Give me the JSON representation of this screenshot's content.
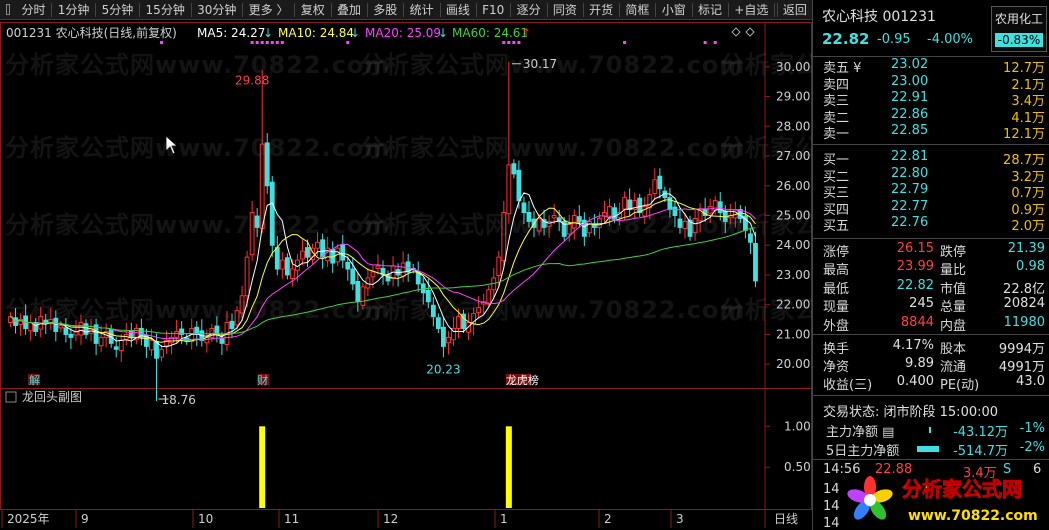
{
  "toolbar": {
    "items": [
      "分时",
      "1分钟",
      "5分钟",
      "15分钟",
      "30分钟",
      "更多 〉",
      "复权",
      "叠加",
      "多股",
      "统计",
      "画线",
      "F10",
      "逐分",
      "同资",
      "开货",
      "简框",
      "小窗",
      "标记",
      "+自选",
      "返回"
    ]
  },
  "chart_header": {
    "code_name": "001231 农心科技(日线,前复权)",
    "ma5": "MA5: 24.27",
    "ma10": "MA10: 24.84",
    "ma20": "MA20: 25.09",
    "ma60": "MA60: 24.61",
    "arrow_down": "↓",
    "arrow_up": "↑"
  },
  "sub_chart": {
    "title": "龙回头副图"
  },
  "annotations": {
    "high_label": "29.88",
    "high2_label": "30.17",
    "low_label": "20.23",
    "low2_label": "18.76",
    "event_jie": "解",
    "event_cai": "财",
    "event_lhb": "龙虎榜"
  },
  "colors": {
    "up": "#ff3030",
    "down": "#3fe0e0",
    "ma5": "#ffffff",
    "ma10": "#ffff40",
    "ma20": "#ff40ff",
    "ma60": "#40d040",
    "signal": "#ffff00"
  },
  "chart_data": [
    {
      "type": "candlestick",
      "y_ticks": [
        "30.00",
        "29.00",
        "28.00",
        "27.00",
        "26.00",
        "25.00",
        "24.00",
        "23.00",
        "22.00",
        "21.00",
        "20.00"
      ],
      "x_ticks": [
        "2025年",
        "9",
        "10",
        "11",
        "12",
        "1",
        "2",
        "3"
      ],
      "ylim": [
        19.4,
        30.7
      ],
      "closes": [
        21.6,
        21.3,
        21.5,
        21.2,
        21.4,
        21.1,
        21.6,
        21.4,
        21.5,
        21.1,
        21.3,
        21.0,
        20.9,
        21.1,
        21.4,
        21.0,
        21.2,
        20.7,
        20.9,
        21.1,
        20.7,
        20.5,
        20.8,
        21.0,
        20.9,
        21.2,
        20.9,
        20.6,
        20.8,
        20.2,
        20.5,
        20.8,
        20.9,
        21.1,
        21.0,
        20.8,
        21.2,
        21.0,
        20.8,
        20.9,
        21.2,
        21.0,
        20.7,
        21.4,
        21.2,
        21.8,
        22.3,
        23.6,
        25.1,
        24.6,
        27.4,
        26.0,
        24.0,
        23.2,
        23.5,
        23.0,
        23.2,
        23.5,
        23.8,
        23.6,
        23.9,
        24.1,
        23.6,
        23.9,
        23.4,
        23.9,
        23.5,
        23.2,
        22.7,
        22.1,
        22.6,
        22.9,
        23.1,
        23.3,
        23.0,
        22.8,
        23.3,
        23.0,
        23.4,
        23.1,
        23.2,
        22.7,
        22.4,
        22.1,
        21.6,
        21.2,
        20.6,
        20.9,
        21.2,
        21.6,
        21.2,
        21.4,
        21.7,
        21.9,
        22.1,
        22.5,
        22.9,
        23.6,
        25.1,
        26.7,
        26.4,
        25.5,
        25.1,
        24.8,
        24.6,
        24.9,
        24.6,
        24.8,
        25.0,
        24.8,
        24.3,
        24.7,
        25.0,
        24.8,
        24.3,
        24.8,
        24.6,
        24.9,
        25.1,
        25.3,
        24.9,
        25.1,
        25.6,
        25.2,
        25.5,
        25.1,
        25.3,
        25.7,
        26.2,
        25.9,
        25.6,
        25.2,
        25.0,
        24.6,
        24.8,
        24.3,
        24.9,
        25.2,
        25.0,
        25.3,
        25.5,
        25.1,
        24.8,
        25.0,
        25.2,
        24.9,
        24.5,
        24.1,
        22.8
      ]
    },
    {
      "type": "bar",
      "title": "龙回头副图",
      "y_ticks": [
        "1.00",
        "0.50"
      ],
      "ylim": [
        0,
        1.2
      ],
      "signals": [
        {
          "index": 50,
          "value": 1
        },
        {
          "index": 99,
          "value": 1
        }
      ]
    }
  ],
  "quote": {
    "name": "农心科技 001231",
    "price": "22.82",
    "change": "-0.95",
    "pct": "-4.00%",
    "sector_name": "农用化工",
    "sector_pct": "-0.83%",
    "asks": [
      {
        "label": "卖五 ¥",
        "price": "23.02",
        "vol": "12.7万"
      },
      {
        "label": "卖四",
        "price": "23.00",
        "vol": "2.1万"
      },
      {
        "label": "卖三",
        "price": "22.91",
        "vol": "3.4万"
      },
      {
        "label": "卖二",
        "price": "22.86",
        "vol": "4.1万"
      },
      {
        "label": "卖一",
        "price": "22.85",
        "vol": "12.1万"
      }
    ],
    "bids": [
      {
        "label": "买一",
        "price": "22.81",
        "vol": "28.7万"
      },
      {
        "label": "买二",
        "price": "22.80",
        "vol": "3.2万"
      },
      {
        "label": "买三",
        "price": "22.79",
        "vol": "0.7万"
      },
      {
        "label": "买四",
        "price": "22.77",
        "vol": "0.9万"
      },
      {
        "label": "买五",
        "price": "22.76",
        "vol": "2.0万"
      }
    ],
    "stats1": [
      {
        "l1": "涨停",
        "v1": "26.15",
        "c1": "cred",
        "l2": "跌停",
        "v2": "21.39",
        "c2": "ccy"
      },
      {
        "l1": "最高",
        "v1": "23.99",
        "c1": "cred",
        "l2": "量比",
        "v2": "0.98",
        "c2": "ccy"
      },
      {
        "l1": "最低",
        "v1": "22.82",
        "c1": "ccy",
        "l2": "市值",
        "v2": "22.8亿",
        "c2": "cwh"
      },
      {
        "l1": "现量",
        "v1": "245",
        "c1": "cwh",
        "l2": "总量",
        "v2": "20824",
        "c2": "cwh"
      },
      {
        "l1": "外盘",
        "v1": "8844",
        "c1": "cred",
        "l2": "内盘",
        "v2": "11980",
        "c2": "ccy"
      }
    ],
    "stats2": [
      {
        "l1": "换手",
        "v1": "4.17%",
        "c1": "cwh",
        "l2": "股本",
        "v2": "9994万",
        "c2": "cwh"
      },
      {
        "l1": "净资",
        "v1": "9.89",
        "c1": "cwh",
        "l2": "流通",
        "v2": "4991万",
        "c2": "cwh"
      },
      {
        "l1": "收益(三)",
        "v1": "0.400",
        "c1": "cwh",
        "l2": "PE(动)",
        "v2": "43.0",
        "c2": "cwh"
      }
    ],
    "trade_status": "交易状态: 闭市阶段 15:00:00",
    "fund1": {
      "label": "主力净额 ▤",
      "value": "-43.12万",
      "pct": "-1%"
    },
    "fund2": {
      "label": "5日主力净额",
      "value": "-514.7万",
      "pct": "-2%"
    },
    "tick": {
      "time": "14:56",
      "price": "22.88",
      "vol": "3.4万",
      "flag": "S",
      "num": "6"
    },
    "tick_more": [
      "14",
      "14",
      "14"
    ]
  },
  "footer": {
    "period": "日线"
  },
  "logo": {
    "title": "分析家公式网",
    "url": "www.70822.com"
  },
  "watermark": "分析家公式网www.70822.com"
}
